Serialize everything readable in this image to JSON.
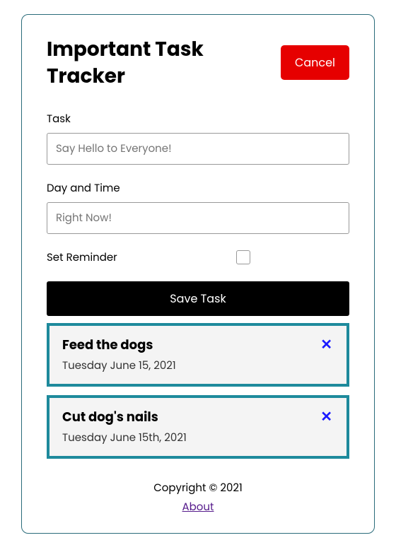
{
  "header": {
    "title": "Important Task Tracker",
    "cancel_label": "Cancel"
  },
  "form": {
    "task_label": "Task",
    "task_placeholder": "Say Hello to Everyone!",
    "daytime_label": "Day and Time",
    "daytime_placeholder": "Right Now!",
    "reminder_label": "Set Reminder",
    "save_label": "Save Task"
  },
  "tasks": [
    {
      "name": "Feed the dogs",
      "date": "Tuesday June 15, 2021"
    },
    {
      "name": "Cut dog's nails",
      "date": "Tuesday June 15th, 2021"
    }
  ],
  "footer": {
    "copyright": "Copyright © 2021",
    "about_label": "About"
  }
}
